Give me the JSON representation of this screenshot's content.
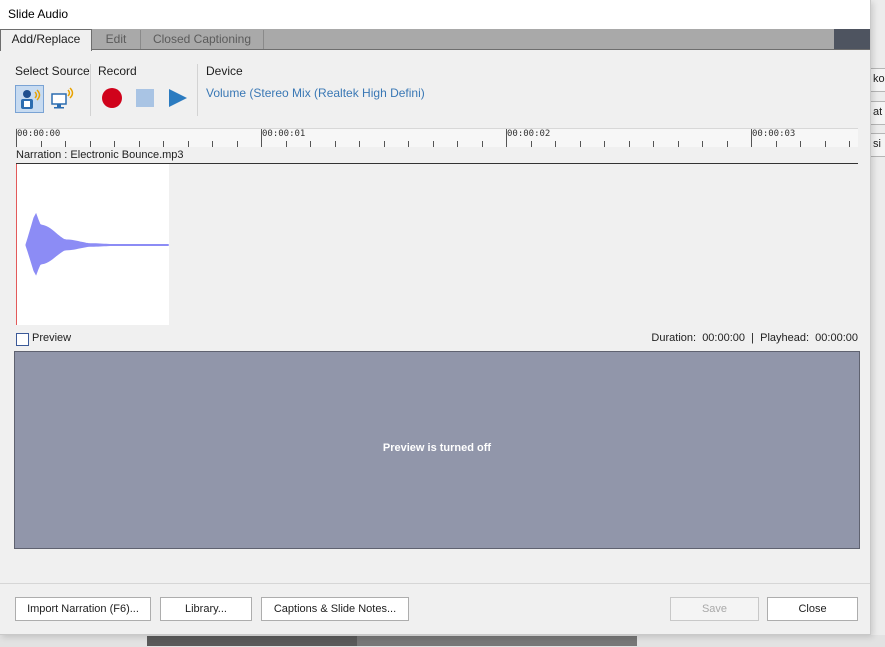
{
  "window": {
    "title": "Slide Audio"
  },
  "tabs": [
    {
      "label": "Add/Replace",
      "active": true
    },
    {
      "label": "Edit",
      "active": false
    },
    {
      "label": "Closed Captioning",
      "active": false
    }
  ],
  "toolbar": {
    "select_source_label": "Select Source",
    "record_label": "Record",
    "device_label": "Device",
    "device_value": "Volume (Stereo Mix (Realtek High Defini)",
    "icons": [
      "microphone-person-icon",
      "computer-audio-icon",
      "record-icon",
      "stop-icon",
      "play-icon"
    ],
    "record_color": "#d0021b",
    "stop_color": "#a9c4e4",
    "play_color": "#2b7bc0"
  },
  "timeline": {
    "markers": [
      "00:00:00",
      "00:00:01",
      "00:00:02",
      "00:00:03"
    ]
  },
  "track": {
    "label": "Narration : Electronic Bounce.mp3",
    "waveform_color": "#8c8cf5"
  },
  "preview": {
    "checkbox_label": "Preview",
    "checked": false,
    "duration_label": "Duration:",
    "duration_value": "00:00:00",
    "playhead_label": "Playhead:",
    "playhead_value": "00:00:00",
    "message": "Preview is turned off"
  },
  "footer": {
    "import_label": "Import Narration (F6)...",
    "library_label": "Library...",
    "captions_label": "Captions & Slide Notes...",
    "save_label": "Save",
    "close_label": "Close"
  }
}
